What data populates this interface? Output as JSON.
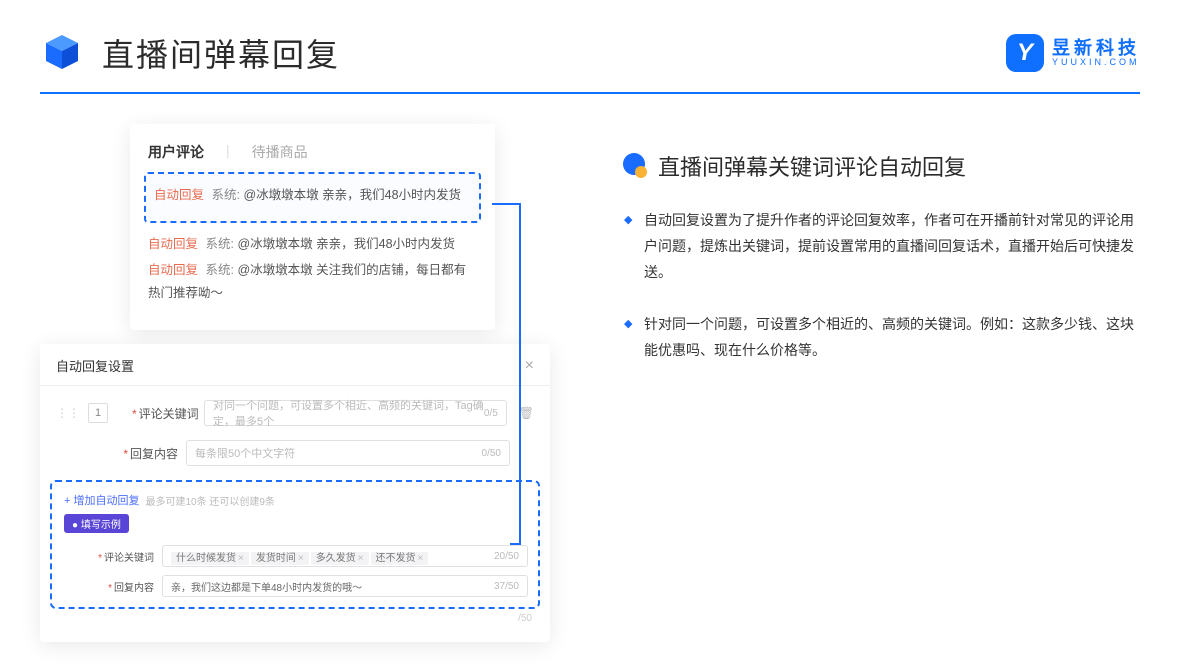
{
  "header": {
    "title": "直播间弹幕回复",
    "brand_name": "昱新科技",
    "brand_sub": "YUUXIN.COM"
  },
  "comments": {
    "tab_active": "用户评论",
    "tab_inactive": "待播商品",
    "auto_label": "自动回复",
    "sys_label": "系统:",
    "line1": "@冰墩墩本墩 亲亲，我们48小时内发货",
    "line2": "@冰墩墩本墩 亲亲，我们48小时内发货",
    "line3": "@冰墩墩本墩 关注我们的店铺，每日都有热门推荐呦～"
  },
  "settings": {
    "title": "自动回复设置",
    "row_num": "1",
    "label_keywords": "评论关键词",
    "ph_keywords": "对同一个问题，可设置多个相近、高频的关键词，Tag确定，最多5个",
    "count_keywords": "0/5",
    "label_content": "回复内容",
    "ph_content": "每条限50个中文字符",
    "count_content": "0/50",
    "add_link": "+ 增加自动回复",
    "add_hint": "最多可建10条 还可以创建9条",
    "example_badge": "● 填写示例",
    "ex_label_keywords": "评论关键词",
    "ex_tags": [
      "什么时候发货",
      "发货时间",
      "多久发货",
      "还不发货"
    ],
    "ex_count_keywords": "20/50",
    "ex_label_content": "回复内容",
    "ex_content_value": "亲，我们这边都是下单48小时内发货的哦～",
    "ex_count_content": "37/50",
    "scroll_hint": "/50"
  },
  "right": {
    "section_title": "直播间弹幕关键词评论自动回复",
    "bullet1": "自动回复设置为了提升作者的评论回复效率，作者可在开播前针对常见的评论用户问题，提炼出关键词，提前设置常用的直播间回复话术，直播开始后可快捷发送。",
    "bullet2": "针对同一个问题，可设置多个相近的、高频的关键词。例如：这款多少钱、这块能优惠吗、现在什么价格等。"
  }
}
